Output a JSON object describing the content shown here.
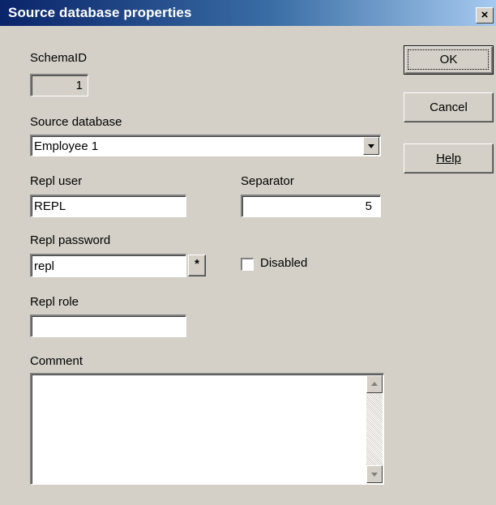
{
  "window": {
    "title": "Source database properties",
    "close_label": "×"
  },
  "buttons": {
    "ok": "OK",
    "cancel": "Cancel",
    "help": "Help"
  },
  "schema_id": {
    "label": "SchemaID",
    "value": "1"
  },
  "source_database": {
    "label": "Source database",
    "value": "Employee 1"
  },
  "repl_user": {
    "label": "Repl user",
    "value": "REPL"
  },
  "separator": {
    "label": "Separator",
    "value": "5"
  },
  "repl_password": {
    "label": "Repl password",
    "value": "repl",
    "reveal_label": "*"
  },
  "disabled": {
    "label": "Disabled",
    "checked": false
  },
  "repl_role": {
    "label": "Repl role",
    "value": ""
  },
  "comment": {
    "label": "Comment",
    "value": ""
  },
  "icons": {
    "dropdown": "chevron-down-icon",
    "scroll_up": "scroll-up-arrow-icon",
    "scroll_down": "scroll-down-arrow-icon"
  },
  "colors": {
    "face": "#d4d0c8",
    "title_start": "#0a246a",
    "title_end": "#a6caf0"
  }
}
